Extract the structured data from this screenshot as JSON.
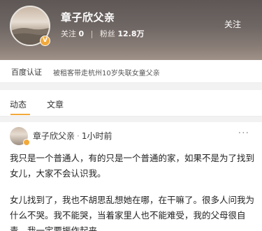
{
  "profile": {
    "name": "章子欣父亲",
    "follow_label": "关注",
    "following_count": "0",
    "fans_label": "粉丝",
    "fans_count": "12.8万",
    "follow_button": "关注",
    "badge": "V"
  },
  "certification": {
    "label": "百度认证",
    "text": "被租客带走杭州10岁失联女童父亲"
  },
  "tabs": [
    {
      "label": "动态"
    },
    {
      "label": "文章"
    }
  ],
  "post": {
    "author": "章子欣父亲",
    "separator": "·",
    "time": "1小时前",
    "more": "···",
    "paragraph1": "我只是一个普通人，有的只是一个普通的家，如果不是为了找到女儿，大家不会认识我。",
    "paragraph2": "女儿找到了，我也不胡思乱想她在哪，在干嘛了。很多人问我为什么不哭。我不能哭，当着家里人也不能难受，我的父母很自责，我一定要振作起来"
  },
  "colors": {
    "accent": "#f2a93b",
    "header_top": "#5e5755",
    "header_bottom": "#a09288"
  }
}
